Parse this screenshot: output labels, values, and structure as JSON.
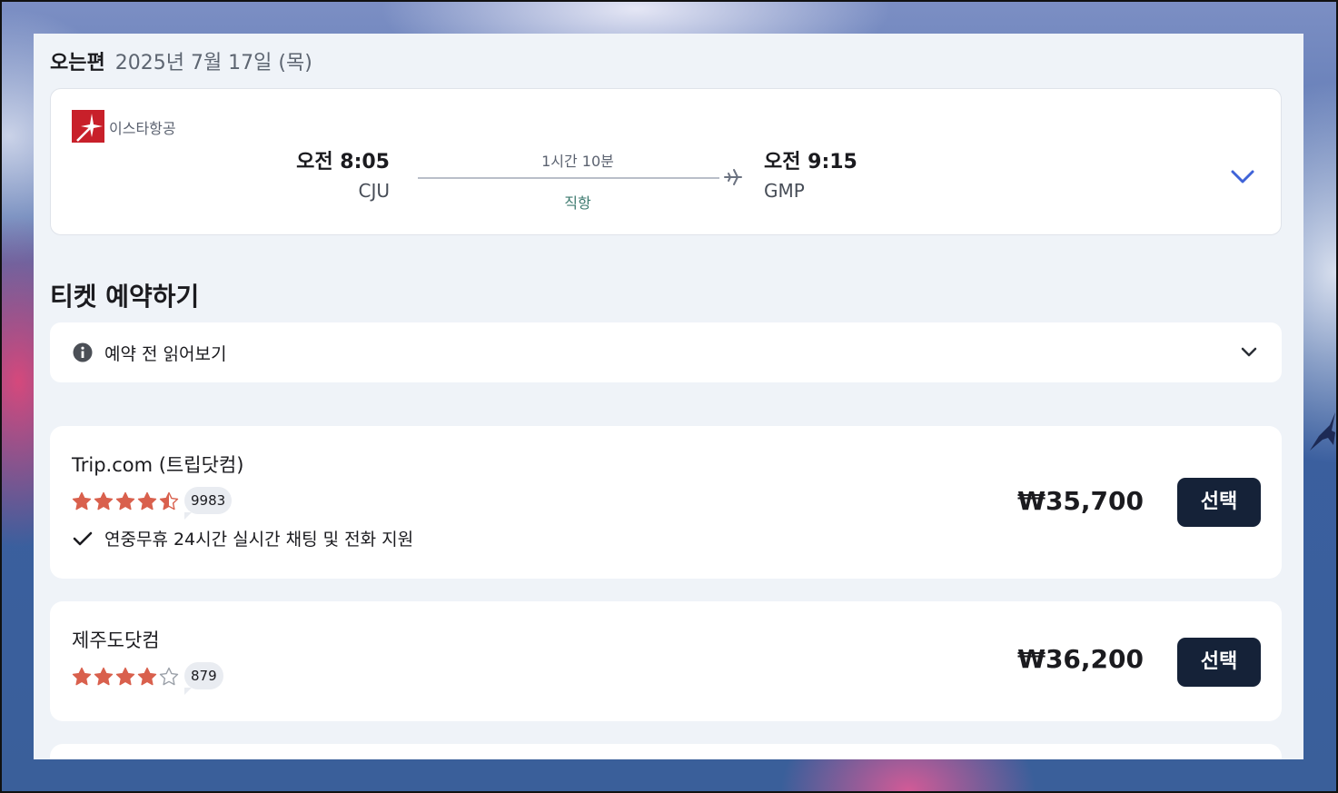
{
  "inbound": {
    "label": "오는편",
    "date": "2025년 7월 17일 (목)"
  },
  "flight": {
    "airline_name": "이스타항공",
    "airline_logo_icon": "eastar-jet-logo-icon",
    "departure_time": "오전 8:05",
    "departure_code": "CJU",
    "duration": "1시간 10분",
    "stops": "직항",
    "arrival_time": "오전 9:15",
    "arrival_code": "GMP",
    "expand_icon": "chevron-down-icon"
  },
  "booking": {
    "title": "티켓 예약하기",
    "notice_label": "예약 전 읽어보기",
    "notice_icon": "info-icon"
  },
  "providers": [
    {
      "name": "Trip.com (트립닷컴)",
      "rating": 4.5,
      "reviews": "9983",
      "feature": "연중무휴 24시간 실시간 채팅 및 전화 지원",
      "price": "₩35,700",
      "select_label": "선택"
    },
    {
      "name": "제주도닷컴",
      "rating": 4,
      "reviews": "879",
      "price": "₩36,200",
      "select_label": "선택"
    }
  ],
  "colors": {
    "star": "#d9604d",
    "button": "#152238",
    "accent_chevron": "#3f63d8",
    "panel_bg": "#eff3f8"
  }
}
